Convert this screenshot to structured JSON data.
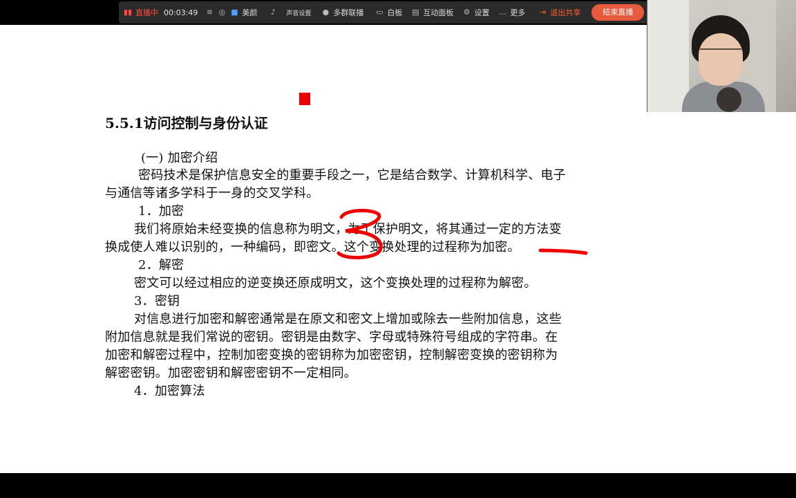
{
  "toolbar": {
    "live_label": "直播中",
    "timer": "00:03:49",
    "beauty_label": "美颜",
    "sound_label": "声音设置",
    "multi_label": "多群联播",
    "whiteboard_label": "白板",
    "interactive_label": "互动面板",
    "settings_label": "设置",
    "more_label": "更多",
    "exit_share_label": "退出共享",
    "end_live_label": "结束直播"
  },
  "slide": {
    "title": "5.5.1访问控制与身份认证",
    "lines": [
      "(一) 加密介绍",
      "密码技术是保护信息安全的重要手段之一，它是结合数学、计算机科学、电子",
      "与通信等诸多学科于一身的交叉学科。",
      "1．加密",
      "我们将原始未经变换的信息称为明文，为了保护明文，将其通过一定的方法变",
      "换成使人难以识别的，一种编码，即密文。这个变换处理的过程称为加密。",
      "2．解密",
      "密文可以经过相应的逆变换还原成明文，这个变换处理的过程称为解密。",
      "3．密钥",
      "对信息进行加密和解密通常是在原文和密文上增加或除去一些附加信息，这些",
      "附加信息就是我们常说的密钥。密钥是由数字、字母或特殊符号组成的字符串。在",
      "加密和解密过程中，控制加密变换的密钥称为加密密钥，控制解密变换的密钥称为",
      "解密密钥。加密密钥和解密密钥不一定相同。",
      "4．加密算法"
    ]
  },
  "colors": {
    "annotation": "#ee0000",
    "end_button": "#e85a3d",
    "live": "#ff4a3d"
  }
}
